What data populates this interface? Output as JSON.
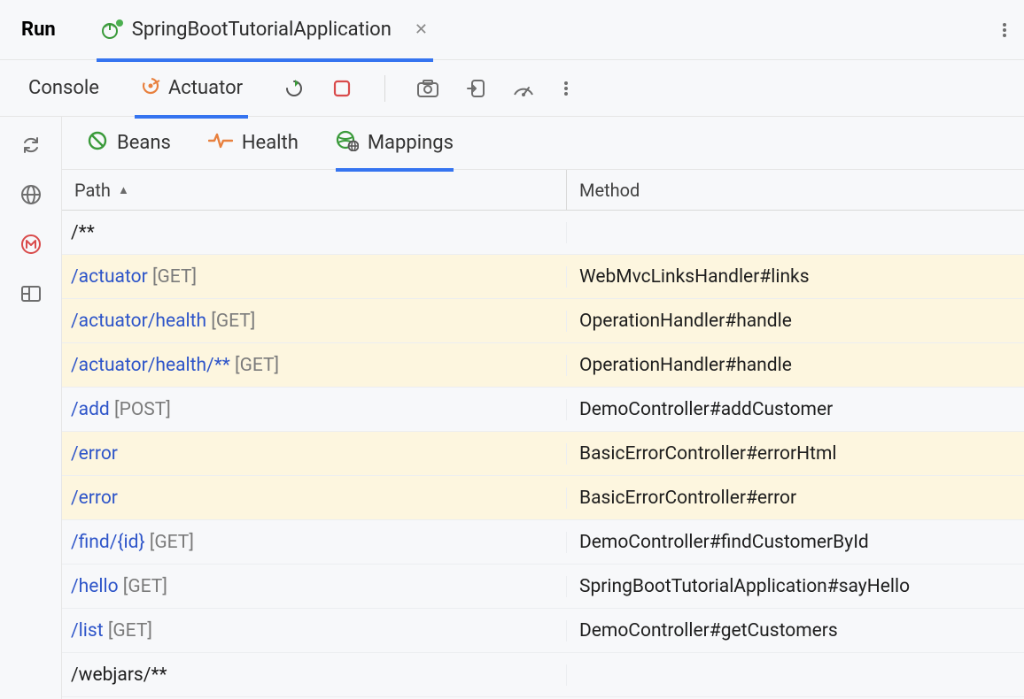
{
  "header": {
    "run_label": "Run",
    "app_name": "SpringBootTutorialApplication"
  },
  "toolbar": {
    "console_tab": "Console",
    "actuator_tab": "Actuator"
  },
  "sub_tabs": {
    "beans": "Beans",
    "health": "Health",
    "mappings": "Mappings"
  },
  "table": {
    "header_path": "Path",
    "header_method": "Method",
    "rows": [
      {
        "path": "/**",
        "verb": "",
        "method": "",
        "link": false,
        "hl": false
      },
      {
        "path": "/actuator",
        "verb": "[GET]",
        "method": "WebMvcLinksHandler#links",
        "link": true,
        "hl": true
      },
      {
        "path": "/actuator/health",
        "verb": "[GET]",
        "method": "OperationHandler#handle",
        "link": true,
        "hl": true
      },
      {
        "path": "/actuator/health/**",
        "verb": "[GET]",
        "method": "OperationHandler#handle",
        "link": true,
        "hl": true
      },
      {
        "path": "/add",
        "verb": "[POST]",
        "method": "DemoController#addCustomer",
        "link": true,
        "hl": false
      },
      {
        "path": "/error",
        "verb": "",
        "method": "BasicErrorController#errorHtml",
        "link": true,
        "hl": true
      },
      {
        "path": "/error",
        "verb": "",
        "method": "BasicErrorController#error",
        "link": true,
        "hl": true
      },
      {
        "path": "/find/{id}",
        "verb": "[GET]",
        "method": "DemoController#findCustomerById",
        "link": true,
        "hl": false
      },
      {
        "path": "/hello",
        "verb": "[GET]",
        "method": "SpringBootTutorialApplication#sayHello",
        "link": true,
        "hl": false
      },
      {
        "path": "/list",
        "verb": "[GET]",
        "method": "DemoController#getCustomers",
        "link": true,
        "hl": false
      },
      {
        "path": "/webjars/**",
        "verb": "",
        "method": "",
        "link": false,
        "hl": false
      }
    ]
  }
}
